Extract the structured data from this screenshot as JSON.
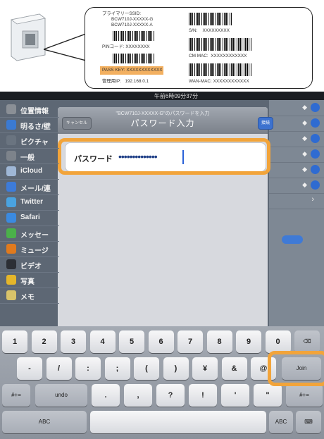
{
  "label_card": {
    "primary_ssid_label": "プライマリーSSID:",
    "ssid_1": "BCW710J-XXXXX-G",
    "ssid_2": "BCW710J-XXXXX-A",
    "sn_label": "S/N:",
    "sn_value": "XXXXXXXXX",
    "pin_label": "PINコード:",
    "pin_value": "XXXXXXXX",
    "cm_mac_label": "CM MAC:",
    "cm_mac_value": "XXXXXXXXXXXX",
    "pass_key_label": "PASS KEY:",
    "pass_key_value": "XXXXXXXXXXXX",
    "admin_ip_label": "管理用IP:",
    "admin_ip_value": "192.168.0.1",
    "wan_mac_label": "WAN-MAC:",
    "wan_mac_value": "XXXXXXXXXXXX",
    "highlight_color": "#f3b060"
  },
  "statusbar": {
    "time": "午前6時09分37分"
  },
  "sidebar": {
    "items": [
      {
        "label": "位置情報",
        "icon": "location-icon",
        "color": "#8a8f96"
      },
      {
        "label": "明るさ/壁",
        "icon": "brightness-icon",
        "color": "#3b7ad2"
      },
      {
        "label": "ピクチャ",
        "icon": "picture-frame-icon",
        "color": "#6a7480"
      },
      {
        "label": "一般",
        "icon": "gear-icon",
        "color": "#7d838b"
      },
      {
        "label": "iCloud",
        "icon": "cloud-icon",
        "color": "#9fb7d6"
      },
      {
        "label": "メール/連",
        "icon": "mail-icon",
        "color": "#3d7bd9"
      },
      {
        "label": "Twitter",
        "icon": "twitter-icon",
        "color": "#4aa3e0"
      },
      {
        "label": "Safari",
        "icon": "safari-icon",
        "color": "#3b8ae0"
      },
      {
        "label": "メッセー",
        "icon": "messages-icon",
        "color": "#4bb14a"
      },
      {
        "label": "ミュージ",
        "icon": "music-icon",
        "color": "#e07a1e"
      },
      {
        "label": "ビデオ",
        "icon": "video-icon",
        "color": "#2c2f35"
      },
      {
        "label": "写真",
        "icon": "photos-icon",
        "color": "#e5b62a"
      },
      {
        "label": "メモ",
        "icon": "notes-icon",
        "color": "#d8c36a"
      }
    ]
  },
  "modal": {
    "prompt": "\"BCW710J-XXXXX-G\"のパスワードを入力",
    "title": "パスワード入力",
    "cancel_label": "キャンセル",
    "join_label": "接続",
    "password_label": "パスワード",
    "password_value": "••••••••••••••",
    "highlight_color": "#f2a43a"
  },
  "keyboard": {
    "row1": [
      "1",
      "2",
      "3",
      "4",
      "5",
      "6",
      "7",
      "8",
      "9",
      "0",
      "⌫"
    ],
    "row2": [
      "-",
      "/",
      ":",
      ";",
      "(",
      ")",
      "¥",
      "&",
      "@"
    ],
    "join_label": "Join",
    "row3": [
      "#+=",
      "undo",
      ".",
      ",",
      "?",
      "!",
      "'",
      "\"",
      "#+="
    ],
    "row4": [
      "ABC",
      "",
      "ABC",
      "⌨"
    ]
  }
}
